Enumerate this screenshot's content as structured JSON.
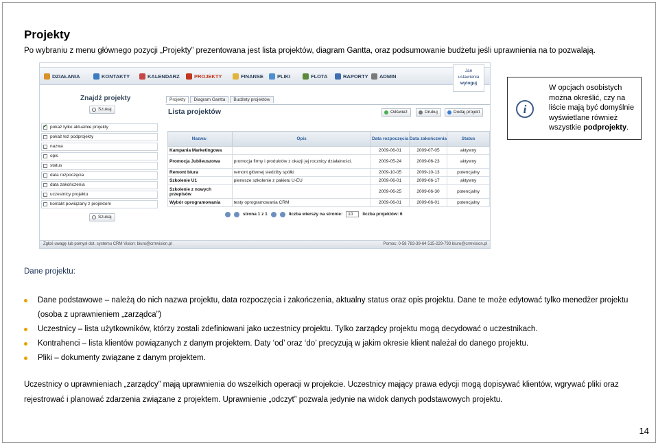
{
  "title": "Projekty",
  "intro": "Po wybraniu z menu głównego pozycji „Projekty” prezentowana jest lista projektów, diagram Gantta, oraz podsumowanie budżetu jeśli uprawnienia na to pozwalają.",
  "screenshot": {
    "nav": [
      "DZIAŁANIA",
      "KONTAKTY",
      "KALENDARZ",
      "PROJEKTY",
      "FINANSE",
      "PLIKI",
      "FLOTA",
      "RAPORTY",
      "ADMIN"
    ],
    "nav_colors": [
      "#d8912c",
      "#3b7bbf",
      "#c64545",
      "#c2351f",
      "#e3b23c",
      "#4d8fcf",
      "#5b8a3a",
      "#3f6fb0",
      "#7a7a7a"
    ],
    "logout": {
      "line1": "Jan",
      "line2": "ustawienia",
      "line3": "wyloguj"
    },
    "sidebar": {
      "title": "Znajdź projekty",
      "search": "Szukaj",
      "filters": [
        {
          "label": "pokaż tylko aktualnie projekty",
          "checked": true
        },
        {
          "label": "pokaż też podprojekty",
          "checked": false
        },
        {
          "label": "nazwa",
          "checked": false
        },
        {
          "label": "opis",
          "checked": false
        },
        {
          "label": "status",
          "checked": false
        },
        {
          "label": "data rozpoczęcia",
          "checked": false
        },
        {
          "label": "data zakończenia",
          "checked": false
        },
        {
          "label": "uczestnicy projektu",
          "checked": false
        },
        {
          "label": "kontakt powiązany z projektem",
          "checked": false
        }
      ]
    },
    "tabs": [
      "Projekty",
      "Diagram Gantta",
      "Budżety projektów"
    ],
    "list_title": "Lista projektów",
    "toolbar": [
      "Odśwież",
      "Drukuj",
      "Dodaj projekt"
    ],
    "columns": [
      "Nazwa↑",
      "Opis",
      "Data rozpoczęcia",
      "Data zakończenia",
      "Status"
    ],
    "rows": [
      {
        "name": "Kampania Marketingowa",
        "desc": "",
        "start": "2009-06-01",
        "end": "2009-07-05",
        "status": "aktywny"
      },
      {
        "name": "Promocja Jubileuszowa",
        "desc": "promocja firmy i produktów z okazji jej rocznicy działalności.",
        "start": "2009-05-24",
        "end": "2009-06-23",
        "status": "aktywny"
      },
      {
        "name": "Remont biura",
        "desc": "remont głównej siedziby spółki",
        "start": "2009-10-05",
        "end": "2009-10-13",
        "status": "potencjalny"
      },
      {
        "name": "Szkolenie U1",
        "desc": "pierwsze szkolenie z pakietu U-EU",
        "start": "2009-06-01",
        "end": "2009-06-17",
        "status": "aktywny"
      },
      {
        "name": "Szkolenie z nowych przepisów",
        "desc": "",
        "start": "2009-06-25",
        "end": "2009-06-30",
        "status": "potencjalny"
      },
      {
        "name": "Wybór oprogramowania",
        "desc": "testy oprogramowania CRM",
        "start": "2009-06-01",
        "end": "2009-06-01",
        "status": "potencjalny"
      }
    ],
    "pager": {
      "page": "strona 1 z 1",
      "rows_label": "liczba wierszy na stronie:",
      "rows_value": "10",
      "count": "liczba projektów: 6"
    },
    "footer_left": "Zgłoś uwagę lub pomysł dot. systemu CRM Vision: biuro@crmvision.pl",
    "footer_right": "Pomoc: 0-58 783-39-64  515-229-793  biuro@crmvision.pl"
  },
  "info_box": "W opcjach osobistych można określić, czy na liście mają być domyślnie wyświetlane również wszystkie podprojekty.",
  "info_box_bold": "podprojekty",
  "section_title": "Dane projektu:",
  "bullets": [
    "Dane podstawowe – należą do nich nazwa projektu, data rozpoczęcia i zakończenia, aktualny status oraz opis projektu. Dane te może edytować tylko menedżer projektu (osoba z uprawnieniem „zarządca”)",
    "Uczestnicy – lista użytkowników, którzy zostali zdefiniowani jako uczestnicy projektu. Tylko zarządcy projektu mogą decydować o uczestnikach.",
    "Kontrahenci – lista klientów powiązanych z danym projektem. Daty ‘od’ oraz ‘do’ precyzują w jakim okresie klient należał do danego projektu.",
    "Pliki – dokumenty związane z danym projektem."
  ],
  "paragraph": "Uczestnicy o uprawnieniach „zarządcy” mają uprawnienia do wszelkich operacji w projekcie. Uczestnicy mający prawa edycji mogą dopisywać klientów, wgrywać pliki oraz rejestrować i planować zdarzenia związane z projektem. Uprawnienie „odczyt” pozwala jedynie na widok danych podstawowych projektu.",
  "page_number": "14"
}
